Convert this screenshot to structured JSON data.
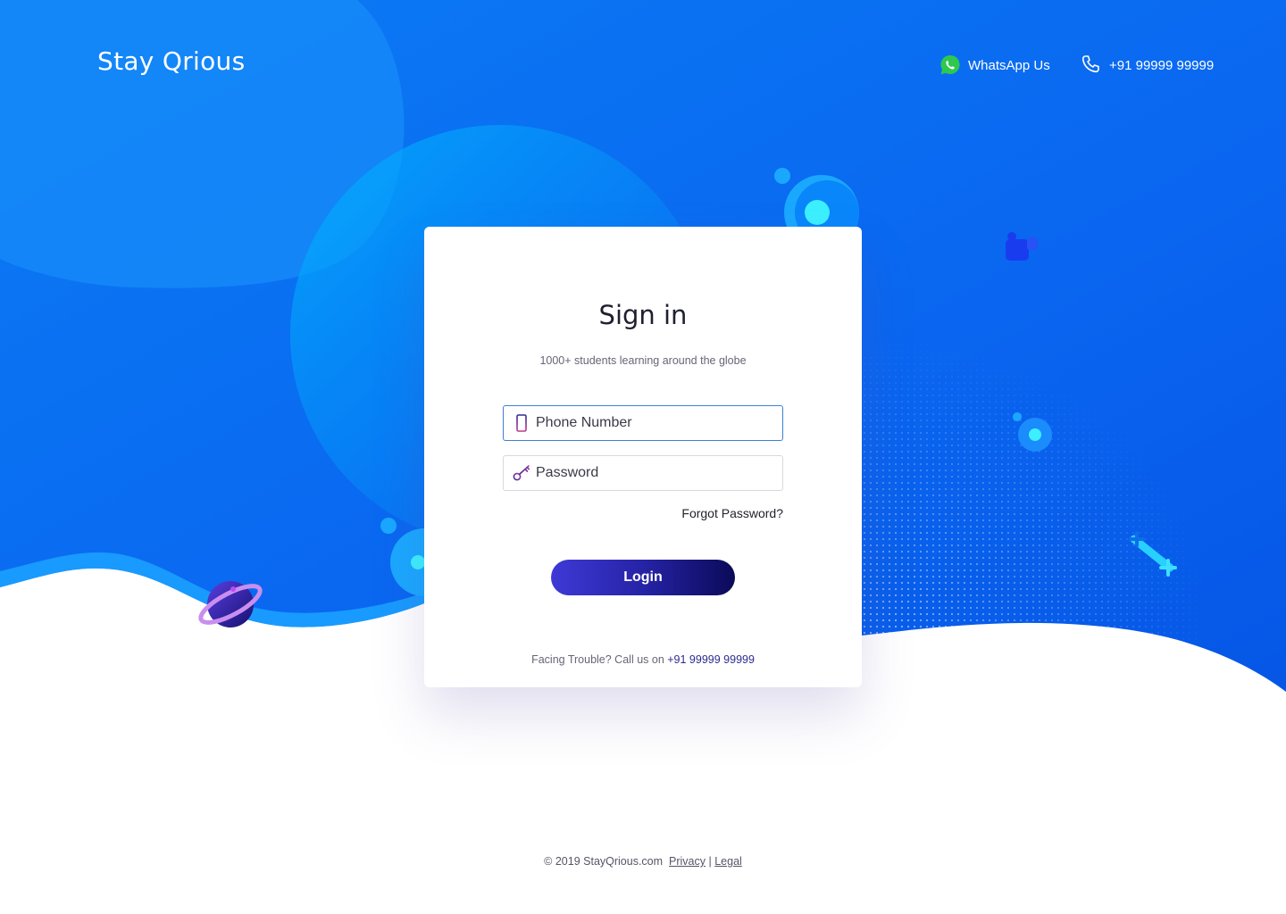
{
  "header": {
    "logo": "Stay Qrious",
    "whatsapp_label": "WhatsApp Us",
    "phone_label": "+91 99999 99999"
  },
  "signin": {
    "title": "Sign in",
    "subtitle": "1000+ students learning around the globe",
    "phone_placeholder": "Phone Number",
    "password_placeholder": "Password",
    "forgot_label": "Forgot Password?",
    "login_label": "Login",
    "trouble_text": "Facing Trouble? Call us on ",
    "trouble_phone": "+91 99999 99999"
  },
  "footer": {
    "copyright": "© 2019 StayQrious.com",
    "privacy_label": "Privacy",
    "separator": "|",
    "legal_label": "Legal"
  },
  "colors": {
    "background_blue": "#0a66f0",
    "whatsapp_green": "#2fc84f",
    "button_start": "#3e39d6",
    "button_end": "#0b0a58",
    "active_border": "#3d7fd6"
  },
  "icons": {
    "whatsapp": "whatsapp-icon",
    "phone": "phone-icon",
    "mobile": "mobile-phone-icon",
    "key": "key-icon",
    "planet": "planet-icon",
    "rocket": "rocket-icon",
    "astronaut": "astronaut-icon"
  }
}
